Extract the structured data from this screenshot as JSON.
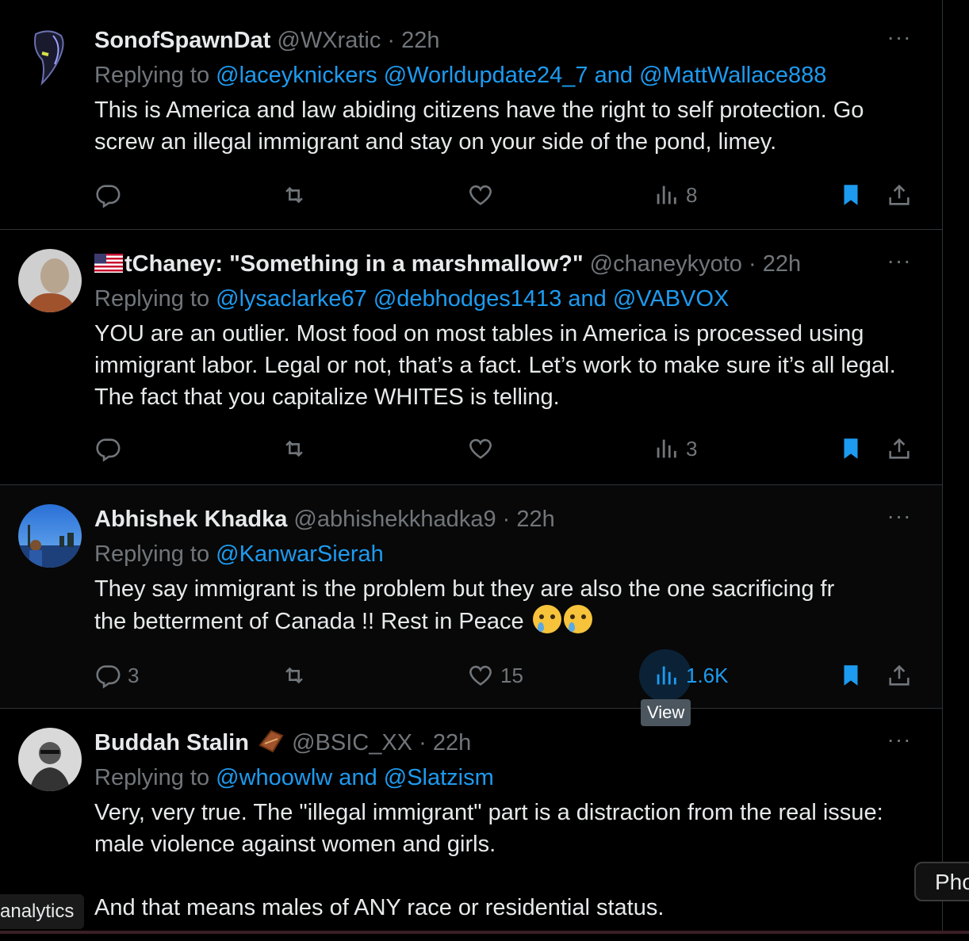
{
  "tweets": [
    {
      "name": "SonofSpawnDat",
      "handle": "@WXratic",
      "dot": "·",
      "time": "22h",
      "replying_prefix": "Replying to",
      "replying_links": "@laceyknickers @Worldupdate24_7 and @MattWallace888",
      "text": "This is America and law abiding citizens have the right to self protection. Go screw an illegal immigrant and stay on your side of the pond, limey.",
      "views": "8"
    },
    {
      "name": "tChaney: \"Something in a marshmallow?\"",
      "handle": "@chaneykyoto",
      "dot": "·",
      "time": "22h",
      "replying_prefix": "Replying to",
      "replying_links": "@lysaclarke67 @debhodges1413 and @VABVOX",
      "text": "YOU are an outlier. Most food on most tables in America is processed using immigrant labor. Legal or not, that’s a fact. Let’s work to make sure it’s all legal. The fact that you capitalize WHITES is telling.",
      "views": "3"
    },
    {
      "name": "Abhishek Khadka",
      "handle": "@abhishekkhadka9",
      "dot": "·",
      "time": "22h",
      "replying_prefix": "Replying to",
      "replying_links": "@KanwarSierah",
      "text_line1": "They say immigrant is the problem but they are also the one sacrificing fr",
      "text_line2": "the betterment of Canada !! Rest in Peace",
      "replies": "3",
      "likes": "15",
      "views": "1.6K",
      "views_tooltip": "View"
    },
    {
      "name": "Buddah Stalin",
      "handle": "@BSIC_XX",
      "dot": "·",
      "time": "22h",
      "replying_prefix": "Replying to",
      "replying_links": "@whoowlw and @Slatzism",
      "text_p1": "Very, very true. The \"illegal immigrant\" part is a distraction from the real issue: male violence against women and girls.",
      "text_p2": "And that means males of ANY race or residential status."
    }
  ],
  "more_label": "···",
  "left_tooltip": "analytics",
  "right_tooltip": "Pho",
  "colors": {
    "accent": "#1d9bf0",
    "muted": "#71767b",
    "text": "#e7e9ea",
    "bg": "#000000"
  }
}
